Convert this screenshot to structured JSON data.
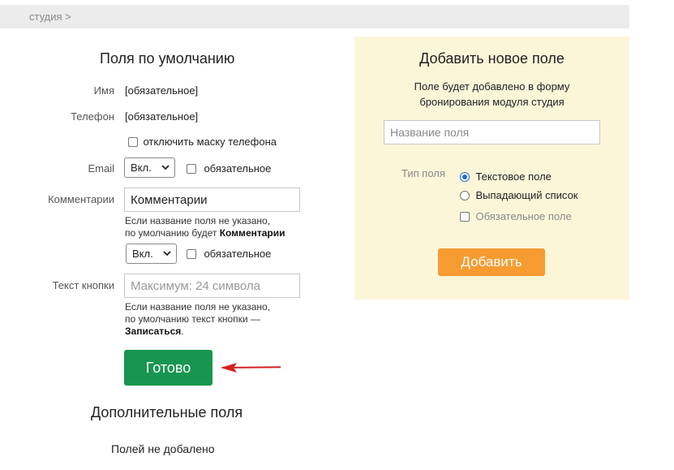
{
  "breadcrumb": "студия >",
  "left": {
    "title": "Поля по умолчанию",
    "name_label": "Имя",
    "name_value": "[обязательное]",
    "phone_label": "Телефон",
    "phone_value": "[обязательное]",
    "phone_mask_label": "отключить маску телефона",
    "email_label": "Email",
    "email_select": "Вкл.",
    "email_required_label": "обязательное",
    "comments_label": "Комментарии",
    "comments_value": "Комментарии",
    "comments_hint_1": "Если название поля не указано,",
    "comments_hint_2": "по умолчанию будет ",
    "comments_hint_bold": "Комментарии",
    "comments_select": "Вкл.",
    "comments_required_label": "обязательное",
    "button_text_label": "Текст кнопки",
    "button_text_placeholder": "Максимум: 24 символа",
    "button_hint_1": "Если название поля не указано,",
    "button_hint_2": "по умолчанию текст кнопки —",
    "button_hint_bold": "Записаться",
    "button_hint_end": ".",
    "done_button": "Готово",
    "extra_title": "Дополнительные поля",
    "extra_empty": "Полей не добалено"
  },
  "right": {
    "title": "Добавить новое поле",
    "desc_1": "Поле будет добавлено в форму",
    "desc_2": "бронирования модуля студия",
    "field_name_placeholder": "Название поля",
    "type_label": "Тип поля",
    "type_options": [
      "Текстовое поле",
      "Выпадающий список"
    ],
    "type_selected": "Текстовое поле",
    "required_label": "Обязательное поле",
    "add_button": "Добавить"
  },
  "colors": {
    "done_button": "#16964f",
    "add_button": "#f59b30",
    "panel_bg": "#fcf6d9",
    "arrow": "#d42020"
  }
}
